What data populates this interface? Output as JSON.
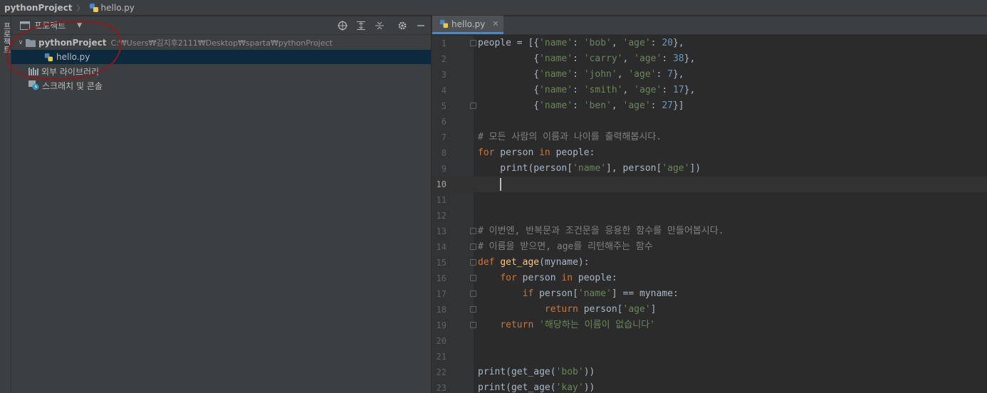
{
  "breadcrumb": {
    "project": "pythonProject",
    "file": "hello.py"
  },
  "tool_strip": {
    "label": "프로젝트"
  },
  "project_panel": {
    "title": "프로젝트",
    "tree": {
      "root_name": "pythonProject",
      "root_path": "C:₩Users₩김지후2111₩Desktop₩sparta₩pythonProject",
      "file": "hello.py",
      "external_libs": "외부 라이브러리",
      "scratches": "스크래치 및 콘솔"
    }
  },
  "editor": {
    "tab": "hello.py",
    "current_line": 10,
    "lines": [
      [
        [
          "c",
          "people = [{"
        ],
        [
          "s",
          "'name'"
        ],
        [
          "c",
          ": "
        ],
        [
          "s",
          "'bob'"
        ],
        [
          "c",
          ", "
        ],
        [
          "s",
          "'age'"
        ],
        [
          "c",
          ": "
        ],
        [
          "n",
          "20"
        ],
        [
          "c",
          "},"
        ]
      ],
      [
        [
          "c",
          "          {"
        ],
        [
          "s",
          "'name'"
        ],
        [
          "c",
          ": "
        ],
        [
          "s",
          "'carry'"
        ],
        [
          "c",
          ", "
        ],
        [
          "s",
          "'age'"
        ],
        [
          "c",
          ": "
        ],
        [
          "n",
          "38"
        ],
        [
          "c",
          "},"
        ]
      ],
      [
        [
          "c",
          "          {"
        ],
        [
          "s",
          "'name'"
        ],
        [
          "c",
          ": "
        ],
        [
          "s",
          "'john'"
        ],
        [
          "c",
          ", "
        ],
        [
          "s",
          "'age'"
        ],
        [
          "c",
          ": "
        ],
        [
          "n",
          "7"
        ],
        [
          "c",
          "},"
        ]
      ],
      [
        [
          "c",
          "          {"
        ],
        [
          "s",
          "'name'"
        ],
        [
          "c",
          ": "
        ],
        [
          "s",
          "'smith'"
        ],
        [
          "c",
          ", "
        ],
        [
          "s",
          "'age'"
        ],
        [
          "c",
          ": "
        ],
        [
          "n",
          "17"
        ],
        [
          "c",
          "},"
        ]
      ],
      [
        [
          "c",
          "          {"
        ],
        [
          "s",
          "'name'"
        ],
        [
          "c",
          ": "
        ],
        [
          "s",
          "'ben'"
        ],
        [
          "c",
          ", "
        ],
        [
          "s",
          "'age'"
        ],
        [
          "c",
          ": "
        ],
        [
          "n",
          "27"
        ],
        [
          "c",
          "}]"
        ]
      ],
      [],
      [
        [
          "m",
          "# 모든 사람의 이름과 나이를 출력해봅시다."
        ]
      ],
      [
        [
          "k",
          "for"
        ],
        [
          "c",
          " person "
        ],
        [
          "k",
          "in"
        ],
        [
          "c",
          " people:"
        ]
      ],
      [
        [
          "c",
          "    print(person["
        ],
        [
          "s",
          "'name'"
        ],
        [
          "c",
          "], person["
        ],
        [
          "s",
          "'age'"
        ],
        [
          "c",
          "])"
        ]
      ],
      [
        [
          "c",
          "    "
        ],
        [
          "caret",
          ""
        ]
      ],
      [],
      [],
      [
        [
          "m",
          "# 이번엔, 반복문과 조건문을 응용한 함수를 만들어봅시다."
        ]
      ],
      [
        [
          "m",
          "# 이름을 받으면, age를 리턴해주는 함수"
        ]
      ],
      [
        [
          "k",
          "def"
        ],
        [
          "c",
          " "
        ],
        [
          "f",
          "get_age"
        ],
        [
          "c",
          "(myname):"
        ]
      ],
      [
        [
          "c",
          "    "
        ],
        [
          "k",
          "for"
        ],
        [
          "c",
          " person "
        ],
        [
          "k",
          "in"
        ],
        [
          "c",
          " people:"
        ]
      ],
      [
        [
          "c",
          "        "
        ],
        [
          "k",
          "if"
        ],
        [
          "c",
          " person["
        ],
        [
          "s",
          "'name'"
        ],
        [
          "c",
          "] == myname:"
        ]
      ],
      [
        [
          "c",
          "            "
        ],
        [
          "k",
          "return"
        ],
        [
          "c",
          " person["
        ],
        [
          "s",
          "'age'"
        ],
        [
          "c",
          "]"
        ]
      ],
      [
        [
          "c",
          "    "
        ],
        [
          "k",
          "return"
        ],
        [
          "c",
          " "
        ],
        [
          "s",
          "'해당하는 이름이 없습니다'"
        ]
      ],
      [],
      [],
      [
        [
          "c",
          "print(get_age("
        ],
        [
          "s",
          "'bob'"
        ],
        [
          "c",
          "))"
        ]
      ],
      [
        [
          "c",
          "print(get_age("
        ],
        [
          "s",
          "'kay'"
        ],
        [
          "c",
          "))"
        ]
      ]
    ]
  },
  "colors": {
    "keyword": "#cc7832",
    "string": "#6a8759",
    "number": "#6897bb",
    "comment": "#808080",
    "function": "#ffc66d",
    "default_code": "#a9b7c6",
    "annotation_circle": "#8b1a1a"
  }
}
